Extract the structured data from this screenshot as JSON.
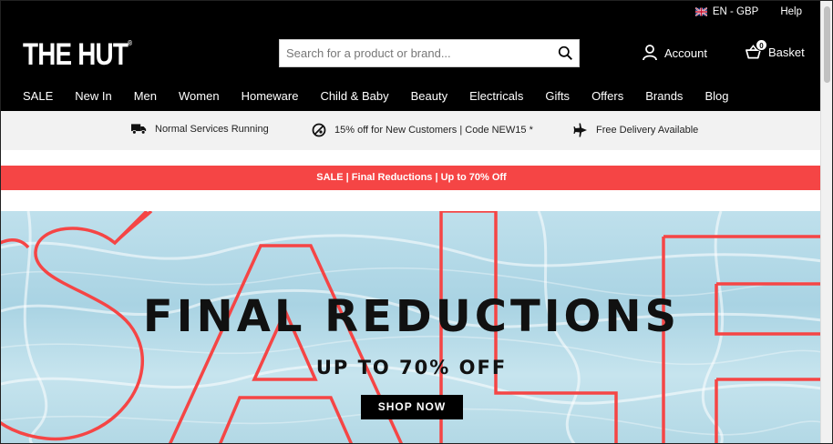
{
  "topbar": {
    "language": "EN - GBP",
    "help": "Help"
  },
  "logo": {
    "text": "THE HUT",
    "mark": "®"
  },
  "search": {
    "placeholder": "Search for a product or brand...",
    "value": ""
  },
  "account": {
    "label": "Account"
  },
  "basket": {
    "label": "Basket",
    "count": "0"
  },
  "nav": {
    "items": [
      "SALE",
      "New In",
      "Men",
      "Women",
      "Homeware",
      "Child & Baby",
      "Beauty",
      "Electricals",
      "Gifts",
      "Offers",
      "Brands",
      "Blog"
    ]
  },
  "usp": {
    "items": [
      {
        "icon": "truck-icon",
        "text": "Normal Services Running"
      },
      {
        "icon": "discount-icon",
        "text": "15% off for New Customers | Code NEW15 *"
      },
      {
        "icon": "plane-icon",
        "text": "Free Delivery Available"
      }
    ]
  },
  "promo": {
    "text": "SALE | Final Reductions | Up to 70% Off"
  },
  "hero": {
    "title": "FINAL REDUCTIONS",
    "subtitle": "UP TO 70% OFF",
    "cta": "SHOP NOW",
    "background_word": "SALE",
    "accent": "#f54545"
  }
}
